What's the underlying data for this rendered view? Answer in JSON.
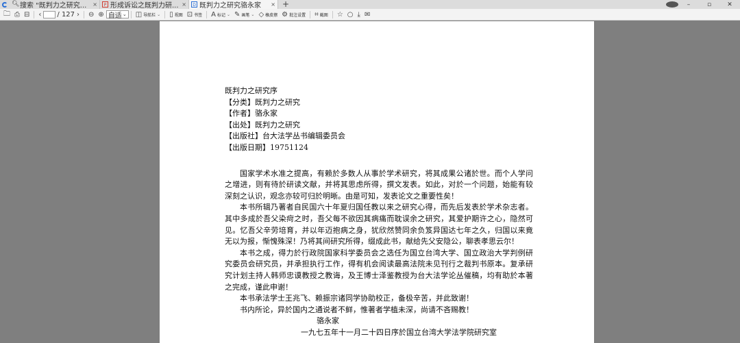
{
  "tabs": [
    {
      "label": "搜索 \"既判力之研究...",
      "icon": "search-icon",
      "close": "×"
    },
    {
      "label": "形成诉讼之既判力研...",
      "icon": "pdf-icon",
      "close": "×"
    },
    {
      "label": "既判力之研究骆永家",
      "icon": "doc-icon",
      "close": "×"
    }
  ],
  "new_tab": "+",
  "window": {
    "minimize": "–",
    "restore": "▫",
    "close": "✕"
  },
  "toolbar": {
    "page_total": "/ 127",
    "zoom": "自适",
    "nav_panel": "导航栏",
    "view": "视图",
    "bookmark": "书签",
    "annotate": "标记",
    "draw": "画笔",
    "eraser": "橡皮擦",
    "settings": "批注设置",
    "screenshot": "截图"
  },
  "document": {
    "meta": [
      "既判力之研究序",
      "【分类】既判力之研究",
      "【作者】骆永家",
      "【出处】既判力之研究",
      "【出版社】台大法学丛书编辑委员会",
      "【出版日期】19751124"
    ],
    "paragraphs": [
      "国家学术水准之提高，有赖於多数人从事於学术研究，将其成果公诸於世。而个人学问之增进，则有待於研读文献，并将其思虑所得，撰文发表。如此，对於一个问题，始能有较深刻之认识，观念亦较可归於明晰。由是可知，发表论文之重要性矣！",
      "本书所辑乃著者自民国六十年夏归国任教以来之研究心得，而先后发表於学术杂志者。其中多成於吾父染疴之时，吾父每不欲因其病痛而耽误余之研究，其爱护期许之心，隐然可见。忆吾父辛劳培育，并以年迈抱病之身，犹欣然赞同余负笈异国达七年之久，归国以来竟无以为报，惭愧殊深！乃将其间研究所得，缀成此书，献给先父安隐公，聊表孝思云尔！",
      "本书之成，得力於行政院国家科学委员会之选任为国立台湾大学、国立政治大学判例研究委员会研究员，并承担执行工作，得有机会阅读最高法院未见刊行之裁判书原本。复承研究计划主持人韩师忠谟教授之教诲，及王博士泽鉴教授为台大法学论丛催稿，均有助於本著之完成，谨此申谢！",
      "本书承法学士王兆飞、赖振宗诸同学协助校正，备极辛苦，并此致谢！",
      "书内所论，异於国内之通说者不鲜，惟著者学植未深，尚请不吝赐教！"
    ],
    "signature": "骆永家",
    "date": "一九七五年十一月二十四日序於国立台湾大学法学院研究室"
  }
}
